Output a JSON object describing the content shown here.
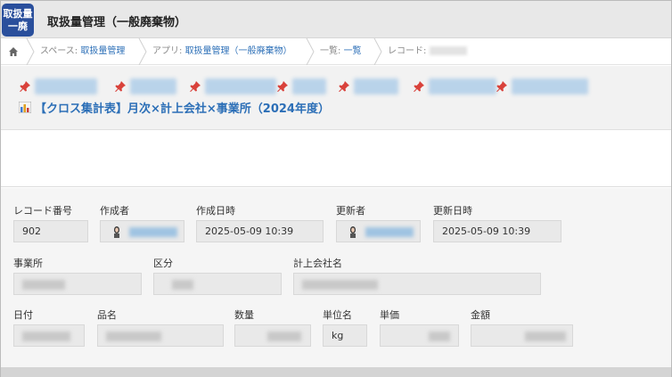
{
  "app": {
    "icon_text": "取扱量\n一廃",
    "title": "取扱量管理（一般廃棄物）"
  },
  "breadcrumb": {
    "space_prefix": "スペース: ",
    "space_link": "取扱量管理",
    "app_prefix": "アプリ: ",
    "app_link": "取扱量管理（一般廃棄物）",
    "list_prefix": "一覧: ",
    "list_link": "一覧",
    "record_prefix": "レコード: "
  },
  "report": {
    "label": "【クロス集計表】月次×計上会社×事業所（2024年度）"
  },
  "record": {
    "record_no_label": "レコード番号",
    "record_no_value": "902",
    "creator_label": "作成者",
    "created_at_label": "作成日時",
    "created_at_value": "2025-05-09 10:39",
    "updater_label": "更新者",
    "updated_at_label": "更新日時",
    "updated_at_value": "2025-05-09 10:39",
    "office_label": "事業所",
    "category_label": "区分",
    "company_label": "計上会社名",
    "date_label": "日付",
    "item_label": "品名",
    "quantity_label": "数量",
    "unit_label": "単位名",
    "unit_value": "kg",
    "price_label": "単価",
    "amount_label": "金額"
  },
  "colors": {
    "app_icon_bg": "#2a4f9c",
    "link": "#2c6fb7",
    "pin": "#d9423b"
  }
}
